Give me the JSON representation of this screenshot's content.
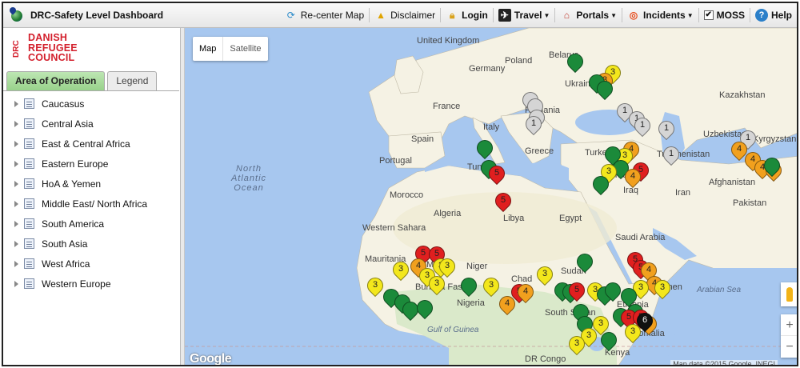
{
  "app": {
    "title": "DRC-Safety Level Dashboard"
  },
  "toolbar": {
    "items": [
      {
        "label": "Re-center Map",
        "icon": "recenter-icon",
        "bold": false
      },
      {
        "label": "Disclaimer",
        "icon": "warning-icon",
        "bold": false
      },
      {
        "label": "Login",
        "icon": "lock-icon",
        "bold": true
      },
      {
        "label": "Travel",
        "icon": "plane-icon",
        "bold": true,
        "dropdown": true
      },
      {
        "label": "Portals",
        "icon": "house-icon",
        "bold": true,
        "dropdown": true
      },
      {
        "label": "Incidents",
        "icon": "lifebuoy-icon",
        "bold": true,
        "dropdown": true
      },
      {
        "label": "MOSS",
        "icon": "checkbox-icon",
        "bold": true,
        "checked": true
      },
      {
        "label": "Help",
        "icon": "help-icon",
        "bold": true
      }
    ]
  },
  "logo": {
    "mark": "DRC",
    "lines": [
      "DANISH",
      "REFUGEE",
      "COUNCIL"
    ],
    "color": "#d31f2c"
  },
  "sidebar": {
    "tabs": [
      {
        "label": "Area of Operation",
        "active": true
      },
      {
        "label": "Legend",
        "active": false
      }
    ],
    "tree": [
      "Caucasus",
      "Central Asia",
      "East & Central Africa",
      "Eastern Europe",
      "HoA & Yemen",
      "Middle East/ North Africa",
      "South America",
      "South Asia",
      "West Africa",
      "Western Europe"
    ]
  },
  "map": {
    "type_buttons": [
      "Map",
      "Satellite"
    ],
    "zoom": [
      "+",
      "−"
    ],
    "branding": "Google",
    "attribution": "Map data ©2015 Google, INEGI",
    "labels": {
      "countries": [
        "United Kingdom",
        "Poland",
        "Belarus",
        "Ukraine",
        "France",
        "Germany",
        "Romania",
        "Italy",
        "Spain",
        "Greece",
        "Turkey",
        "Syria",
        "Iraq",
        "Iran",
        "Kazakhstan",
        "Uzbekistan",
        "Kyrgyzstan",
        "Turkmenistan",
        "Afghanistan",
        "Pakistan",
        "Morocco",
        "Algeria",
        "Libya",
        "Egypt",
        "Saudi Arabia",
        "Western Sahara",
        "Mauritania",
        "Mali",
        "Niger",
        "Chad",
        "Sudan",
        "Nigeria",
        "Burkina Faso",
        "South Sudan",
        "Somalia",
        "DR Congo",
        "Portugal",
        "Tunisia",
        "Kenya",
        "Ethiopia",
        "Yemen"
      ],
      "oceans": [
        "North Atlantic Ocean",
        "Arabian Sea",
        "Gulf of Guinea"
      ]
    },
    "legend_colors": {
      "green": "#1b8a3a",
      "yellow": "#f3e71c",
      "orange": "#f1a01e",
      "red": "#e01f1f",
      "grey": "#d5d5d5",
      "black": "#111111"
    },
    "markers": [
      {
        "c": "green",
        "n": ""
      },
      {
        "c": "yellow",
        "n": "3"
      },
      {
        "c": "orange",
        "n": "3"
      },
      {
        "c": "green",
        "n": ""
      },
      {
        "c": "green",
        "n": ""
      },
      {
        "c": "grey",
        "n": ""
      },
      {
        "c": "grey",
        "n": ""
      },
      {
        "c": "grey",
        "n": ""
      },
      {
        "c": "grey",
        "n": "1"
      },
      {
        "c": "grey",
        "n": "1"
      },
      {
        "c": "grey",
        "n": "1"
      },
      {
        "c": "grey",
        "n": "1"
      },
      {
        "c": "grey",
        "n": "1"
      },
      {
        "c": "grey",
        "n": "1"
      },
      {
        "c": "grey",
        "n": "1"
      },
      {
        "c": "orange",
        "n": "4"
      },
      {
        "c": "orange",
        "n": "4"
      },
      {
        "c": "orange",
        "n": "4"
      },
      {
        "c": "orange",
        "n": "4"
      },
      {
        "c": "green",
        "n": ""
      },
      {
        "c": "green",
        "n": ""
      },
      {
        "c": "green",
        "n": ""
      },
      {
        "c": "red",
        "n": "5"
      },
      {
        "c": "red",
        "n": "5"
      },
      {
        "c": "orange",
        "n": "4"
      },
      {
        "c": "yellow",
        "n": "3"
      },
      {
        "c": "green",
        "n": ""
      },
      {
        "c": "green",
        "n": ""
      },
      {
        "c": "red",
        "n": "5"
      },
      {
        "c": "orange",
        "n": "4"
      },
      {
        "c": "yellow",
        "n": "3"
      },
      {
        "c": "green",
        "n": ""
      },
      {
        "c": "red",
        "n": "5"
      },
      {
        "c": "red",
        "n": "5"
      },
      {
        "c": "orange",
        "n": "4"
      },
      {
        "c": "yellow",
        "n": "3"
      },
      {
        "c": "yellow",
        "n": "3"
      },
      {
        "c": "yellow",
        "n": "3"
      },
      {
        "c": "yellow",
        "n": "3"
      },
      {
        "c": "yellow",
        "n": "3"
      },
      {
        "c": "green",
        "n": ""
      },
      {
        "c": "green",
        "n": ""
      },
      {
        "c": "green",
        "n": ""
      },
      {
        "c": "green",
        "n": ""
      },
      {
        "c": "yellow",
        "n": "3"
      },
      {
        "c": "green",
        "n": ""
      },
      {
        "c": "yellow",
        "n": "3"
      },
      {
        "c": "red",
        "n": "5"
      },
      {
        "c": "orange",
        "n": "4"
      },
      {
        "c": "orange",
        "n": "4"
      },
      {
        "c": "yellow",
        "n": "3"
      },
      {
        "c": "green",
        "n": ""
      },
      {
        "c": "green",
        "n": ""
      },
      {
        "c": "green",
        "n": ""
      },
      {
        "c": "red",
        "n": "5"
      },
      {
        "c": "yellow",
        "n": "3"
      },
      {
        "c": "green",
        "n": ""
      },
      {
        "c": "green",
        "n": ""
      },
      {
        "c": "red",
        "n": "5"
      },
      {
        "c": "red",
        "n": "5"
      },
      {
        "c": "orange",
        "n": "4"
      },
      {
        "c": "orange",
        "n": "4"
      },
      {
        "c": "yellow",
        "n": "3"
      },
      {
        "c": "yellow",
        "n": "3"
      },
      {
        "c": "green",
        "n": ""
      },
      {
        "c": "green",
        "n": ""
      },
      {
        "c": "green",
        "n": ""
      },
      {
        "c": "red",
        "n": "5"
      },
      {
        "c": "red",
        "n": "5"
      },
      {
        "c": "orange",
        "n": "4"
      },
      {
        "c": "yellow",
        "n": "3"
      },
      {
        "c": "black",
        "n": "6"
      },
      {
        "c": "green",
        "n": ""
      },
      {
        "c": "green",
        "n": ""
      },
      {
        "c": "yellow",
        "n": "3"
      },
      {
        "c": "yellow",
        "n": "3"
      },
      {
        "c": "yellow",
        "n": "3"
      },
      {
        "c": "green",
        "n": ""
      },
      {
        "c": "green",
        "n": ""
      },
      {
        "c": "yellow",
        "n": "3"
      }
    ]
  }
}
